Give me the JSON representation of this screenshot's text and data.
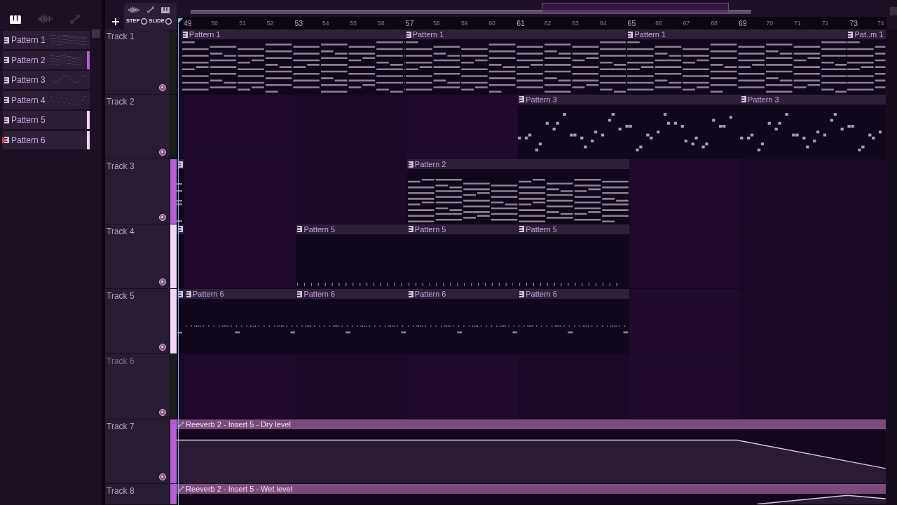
{
  "browser": {
    "filters": [
      {
        "kind": "piano",
        "selected": true
      },
      {
        "kind": "audio",
        "selected": false
      },
      {
        "kind": "automation",
        "selected": false
      }
    ],
    "patterns": [
      {
        "label": "Pattern 1",
        "selected": false
      },
      {
        "label": "Pattern 2",
        "color": "#b35dd7",
        "selected": false
      },
      {
        "label": "Pattern 3",
        "selected": false
      },
      {
        "label": "Pattern 4",
        "selected": false
      },
      {
        "label": "Pattern 5",
        "color": "#f6d6f6",
        "selected": false
      },
      {
        "label": "Pattern 6",
        "color": "#f6d6f6",
        "selected": true
      }
    ]
  },
  "toolbar": {
    "tools": [
      {
        "kind": "audio"
      },
      {
        "kind": "automation"
      },
      {
        "kind": "piano"
      }
    ],
    "toggles": [
      {
        "label": "STEP",
        "on": false
      },
      {
        "label": "SLIDE",
        "on": false
      }
    ]
  },
  "ruler": [
    "49",
    "50",
    "51",
    "52",
    "53",
    "54",
    "55",
    "56",
    "57",
    "58",
    "59",
    "60",
    "61",
    "62",
    "63",
    "64",
    "65",
    "66",
    "67",
    "68",
    "69",
    "70",
    "71",
    "72",
    "73",
    "74"
  ],
  "tracks": [
    {
      "name": "Track 1",
      "muted": false,
      "clips": [
        {
          "kind": "pattern",
          "label": "Pattern 1"
        },
        {
          "kind": "pattern",
          "label": "Pattern 1"
        },
        {
          "kind": "pattern",
          "label": "Pattern 1"
        },
        {
          "kind": "pattern",
          "label": "Pat..m 1"
        }
      ]
    },
    {
      "name": "Track 2",
      "muted": false,
      "clips": [
        {
          "kind": "pattern",
          "label": "Pattern 3"
        },
        {
          "kind": "pattern",
          "label": "Pattern 3"
        }
      ]
    },
    {
      "name": "Track 3",
      "muted": false,
      "color": "#b35dd7",
      "clips": [
        {
          "kind": "pattern"
        },
        {
          "kind": "pattern",
          "label": "Pattern 2"
        }
      ]
    },
    {
      "name": "Track 4",
      "muted": false,
      "color": "#f6d6f6",
      "clips": [
        {
          "kind": "pattern"
        },
        {
          "kind": "pattern",
          "label": "Pattern 5"
        },
        {
          "kind": "pattern",
          "label": "Pattern 5"
        },
        {
          "kind": "pattern",
          "label": "Pattern 5"
        }
      ]
    },
    {
      "name": "Track 5",
      "muted": false,
      "color": "#f6d6f6",
      "clips": [
        {
          "kind": "pattern"
        },
        {
          "kind": "pattern",
          "label": "Pattern 6"
        },
        {
          "kind": "pattern",
          "label": "Pattern 6"
        },
        {
          "kind": "pattern",
          "label": "Pattern 6"
        },
        {
          "kind": "pattern",
          "label": "Pattern 6"
        }
      ]
    },
    {
      "name": "Track 6",
      "muted": true
    },
    {
      "name": "Track 7",
      "muted": false,
      "color": "#b35dd7",
      "clips": [
        {
          "kind": "automation",
          "label": "Reeverb 2 - Insert 5 - Dry level"
        }
      ]
    },
    {
      "name": "Track 8",
      "muted": false,
      "color": "#b35dd7",
      "clips": [
        {
          "kind": "automation",
          "label": "Reeverb 2 - Insert 5 - Wet level"
        }
      ]
    }
  ]
}
